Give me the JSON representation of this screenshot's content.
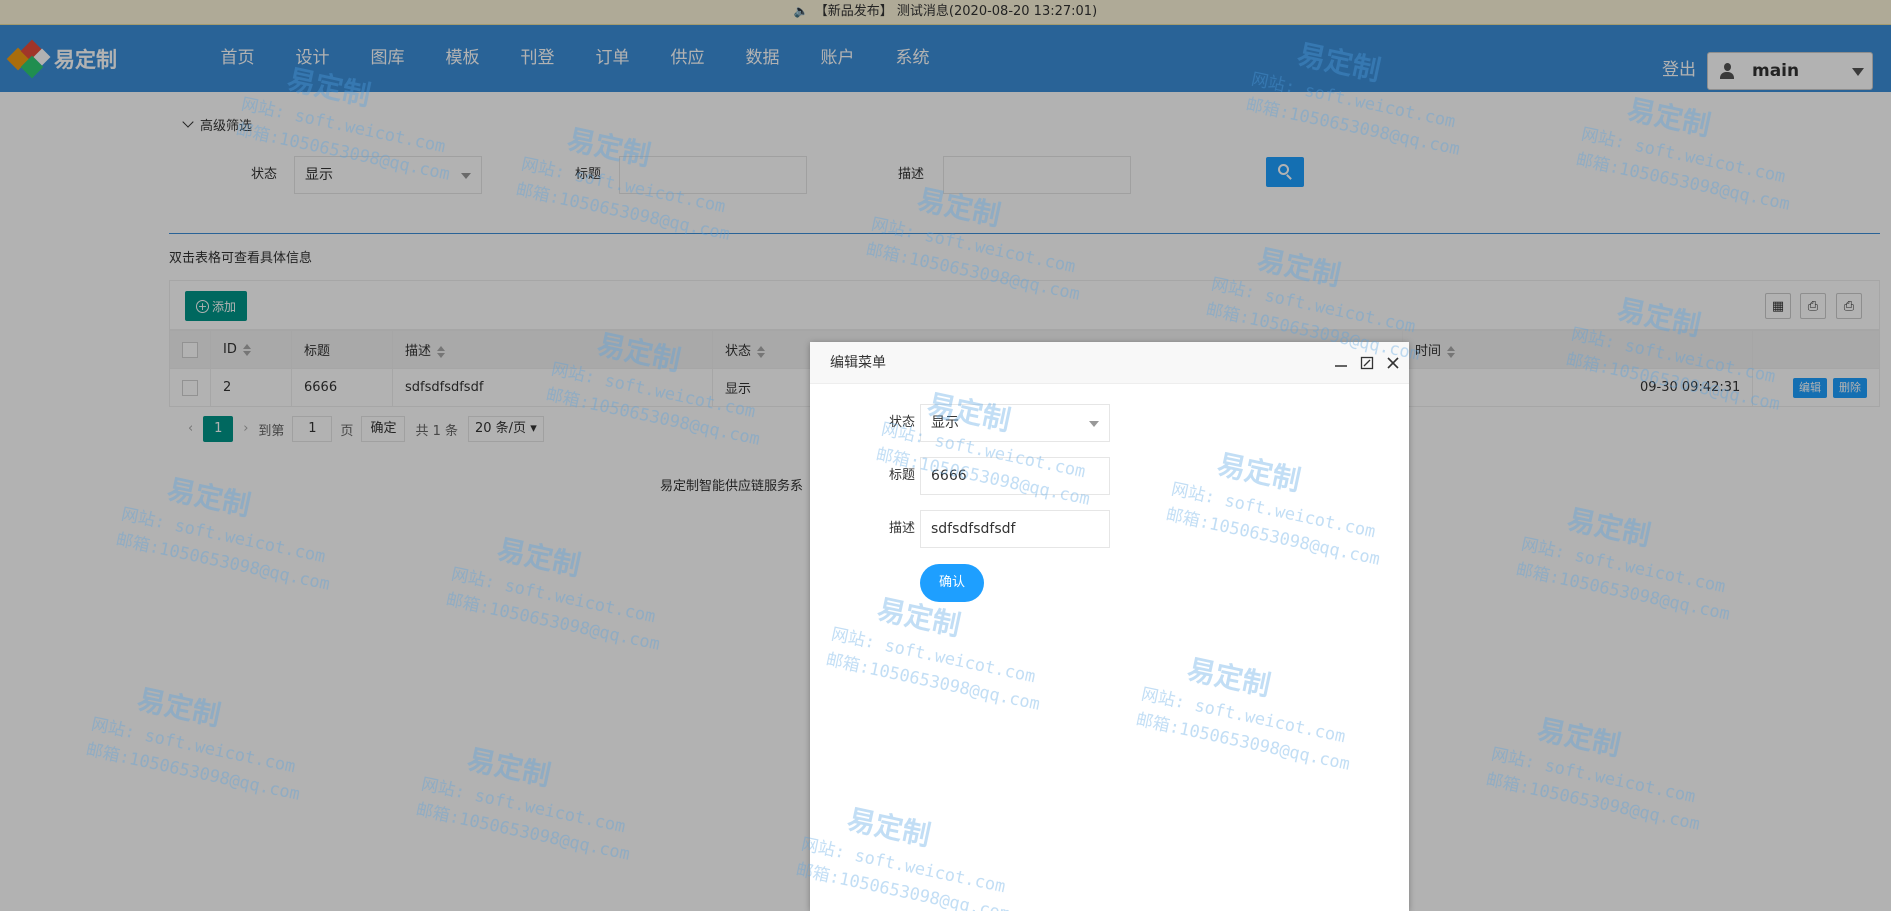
{
  "notice": {
    "text": "【新品发布】  测试消息(2020-08-20 13:27:01)"
  },
  "header": {
    "logo_text": "易定制",
    "nav": [
      "首页",
      "设计",
      "图库",
      "模板",
      "刊登",
      "订单",
      "供应",
      "数据",
      "账户",
      "系统"
    ],
    "logout": "登出",
    "user": "main"
  },
  "filter": {
    "toggle": "高级筛选",
    "status_label": "状态",
    "status_value": "显示",
    "title_label": "标题",
    "desc_label": "描述"
  },
  "hint": "双击表格可查看具体信息",
  "toolbar": {
    "add": "添加"
  },
  "table": {
    "headers": [
      "ID",
      "标题",
      "描述",
      "状态",
      "时间"
    ],
    "rows": [
      {
        "id": "2",
        "title": "6666",
        "desc": "sdfsdfsdfsdf",
        "status": "显示",
        "time": "09-30 09:42:31",
        "edit": "编辑",
        "del": "删除"
      }
    ]
  },
  "pager": {
    "current": "1",
    "goto_label": "到第",
    "page_input": "1",
    "page_unit": "页",
    "confirm": "确定",
    "total": "共 1 条",
    "per_page": "20 条/页"
  },
  "footer": "易定制智能供应链服务系",
  "modal": {
    "title": "编辑菜单",
    "status_label": "状态",
    "status_value": "显示",
    "title_label": "标题",
    "title_value": "6666",
    "desc_label": "描述",
    "desc_value": "sdfsdfsdfsdf",
    "confirm": "确认"
  },
  "watermark": {
    "brand": "易定制",
    "site": "网站: soft.weicot.com",
    "email": "邮箱:1050653098@qq.com"
  },
  "colors": {
    "header": "#3c8fd9",
    "accent": "#1e9fff",
    "green": "#009688"
  }
}
